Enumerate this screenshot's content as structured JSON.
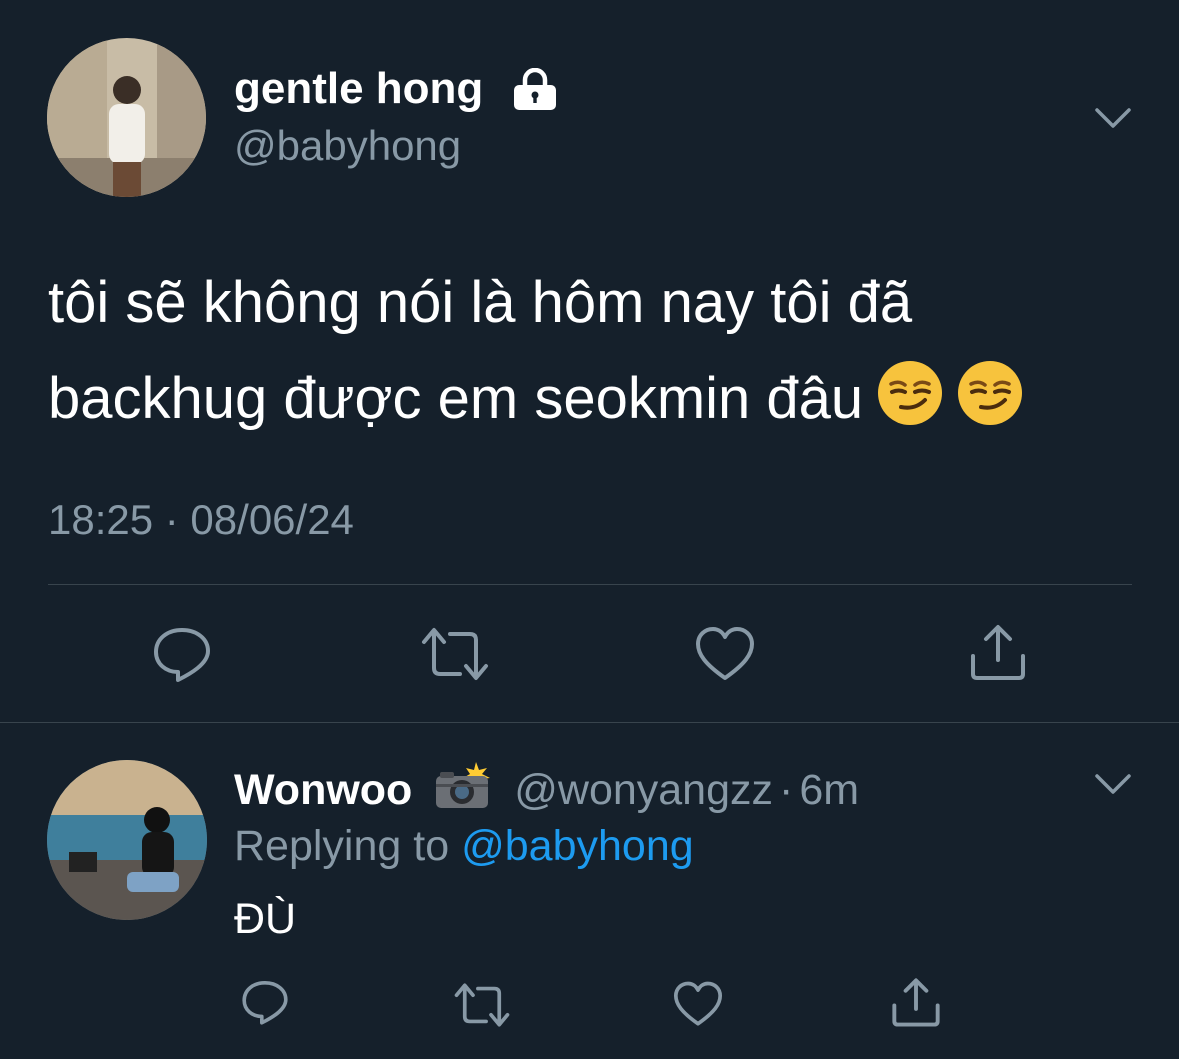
{
  "main_tweet": {
    "display_name": "gentle hong",
    "handle": "@babyhong",
    "protected_icon": "lock-icon",
    "text_line1": "tôi sẽ không nói là hôm nay tôi đã",
    "text_line2": "backhug được em seokmin đâu",
    "emojis": [
      "smirking-face",
      "smirking-face"
    ],
    "timestamp": "18:25 · 08/06/24",
    "actions": [
      "reply-icon",
      "retweet-icon",
      "like-icon",
      "share-icon"
    ]
  },
  "reply": {
    "display_name": "Wonwoo",
    "badge_icon": "camera-flash-icon",
    "handle": "@wonyangzz",
    "separator": "·",
    "time": "6m",
    "replying_label": "Replying to",
    "replying_to": "@babyhong",
    "text": "ĐÙ",
    "actions": [
      "reply-icon",
      "retweet-icon",
      "like-icon",
      "share-icon"
    ]
  },
  "colors": {
    "background": "#15202b",
    "muted": "#8899a6",
    "link": "#1d9bf0",
    "divider": "#38444d"
  }
}
